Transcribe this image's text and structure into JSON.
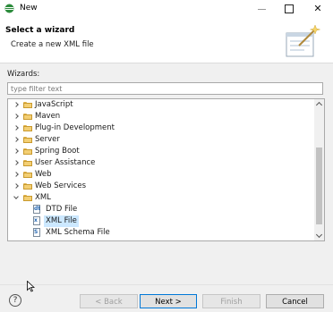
{
  "window": {
    "title": "New",
    "minimize_label": "–",
    "maximize_label": "",
    "close_label": "✕"
  },
  "header": {
    "title": "Select a wizard",
    "description": "Create a new XML file"
  },
  "wizards": {
    "label": "Wizards:",
    "filter_placeholder": "type filter text"
  },
  "tree": {
    "items": [
      {
        "label": "JavaScript",
        "type": "folder",
        "state": "collapsed"
      },
      {
        "label": "Maven",
        "type": "folder",
        "state": "collapsed"
      },
      {
        "label": "Plug-in Development",
        "type": "folder",
        "state": "collapsed"
      },
      {
        "label": "Server",
        "type": "folder",
        "state": "collapsed"
      },
      {
        "label": "Spring Boot",
        "type": "folder",
        "state": "collapsed"
      },
      {
        "label": "User Assistance",
        "type": "folder",
        "state": "collapsed"
      },
      {
        "label": "Web",
        "type": "folder",
        "state": "collapsed"
      },
      {
        "label": "Web Services",
        "type": "folder",
        "state": "collapsed"
      },
      {
        "label": "XML",
        "type": "folder",
        "state": "expanded"
      },
      {
        "label": "DTD File",
        "type": "file",
        "icon": "dtd-file-icon",
        "selected": false
      },
      {
        "label": "XML File",
        "type": "file",
        "icon": "xml-file-icon",
        "selected": true
      },
      {
        "label": "XML Schema File",
        "type": "file",
        "icon": "xml-schema-file-icon",
        "selected": false
      }
    ]
  },
  "footer": {
    "help_label": "?",
    "back_label": "< Back",
    "next_label": "Next >",
    "finish_label": "Finish",
    "cancel_label": "Cancel"
  },
  "colors": {
    "selection": "#cce8ff",
    "default_button_border": "#0078d7",
    "folder": "#f3cf74"
  }
}
